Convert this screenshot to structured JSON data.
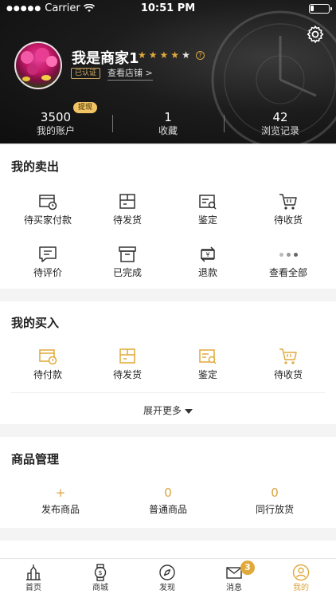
{
  "status_bar": {
    "carrier": "Carrier",
    "time": "10:51 PM"
  },
  "profile": {
    "name": "我是商家1",
    "rating": 4,
    "rating_max": 5,
    "verified_label": "已认证",
    "store_link": "查看店铺 >",
    "withdraw_label": "提现"
  },
  "stats": [
    {
      "value": "3500",
      "label": "我的账户"
    },
    {
      "value": "1",
      "label": "收藏"
    },
    {
      "value": "42",
      "label": "浏览记录"
    }
  ],
  "sales": {
    "title": "我的卖出",
    "items": [
      {
        "label": "待买家付款",
        "icon": "pending-payment-icon"
      },
      {
        "label": "待发货",
        "icon": "pending-shipment-icon"
      },
      {
        "label": "鉴定",
        "icon": "appraisal-icon"
      },
      {
        "label": "待收货",
        "icon": "pending-receipt-icon"
      },
      {
        "label": "待评价",
        "icon": "pending-review-icon"
      },
      {
        "label": "已完成",
        "icon": "completed-icon"
      },
      {
        "label": "退款",
        "icon": "refund-icon"
      },
      {
        "label": "查看全部",
        "icon": "more-dots-icon"
      }
    ]
  },
  "purchases": {
    "title": "我的买入",
    "items": [
      {
        "label": "待付款",
        "icon": "pending-payment-icon"
      },
      {
        "label": "待发货",
        "icon": "pending-shipment-icon"
      },
      {
        "label": "鉴定",
        "icon": "appraisal-icon"
      },
      {
        "label": "待收货",
        "icon": "pending-receipt-icon"
      }
    ],
    "expand_label": "展开更多"
  },
  "goods": {
    "title": "商品管理",
    "items": [
      {
        "value": "+",
        "label": "发布商品"
      },
      {
        "value": "0",
        "label": "普通商品"
      },
      {
        "value": "0",
        "label": "同行放货"
      }
    ]
  },
  "tabs": [
    {
      "label": "首页",
      "icon": "home-building-icon"
    },
    {
      "label": "商城",
      "icon": "mall-watch-icon"
    },
    {
      "label": "发现",
      "icon": "discover-compass-icon"
    },
    {
      "label": "消息",
      "icon": "message-envelope-icon"
    },
    {
      "label": "我的",
      "icon": "profile-icon"
    }
  ],
  "message_badge": "3",
  "colors": {
    "accent": "#e0a93a",
    "dark_header": "#1c1c1c"
  }
}
